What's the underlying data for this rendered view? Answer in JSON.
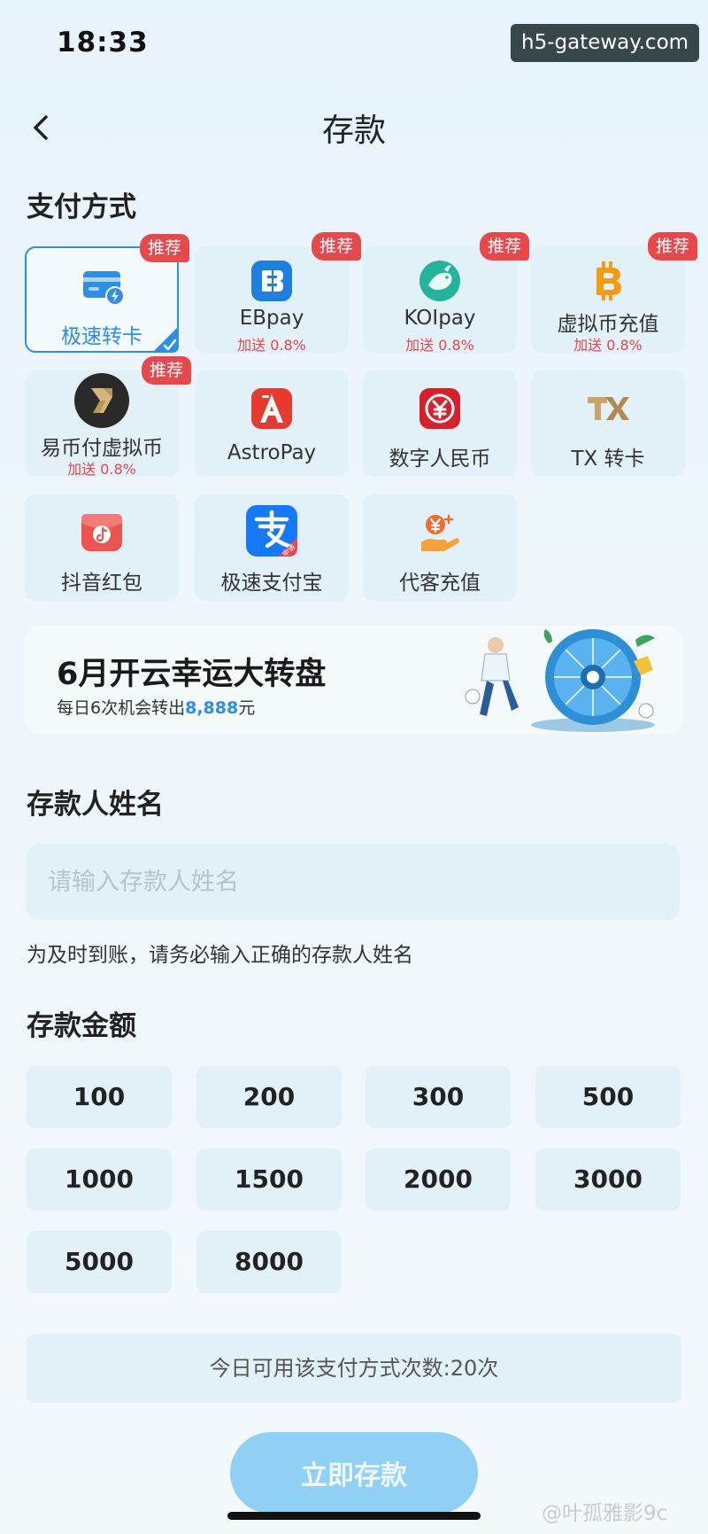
{
  "status_bar": {
    "time": "18:33",
    "host": "h5-gateway.com"
  },
  "header": {
    "title": "存款"
  },
  "payment_section": {
    "title": "支付方式"
  },
  "payment_methods": [
    {
      "label": "极速转卡",
      "badge": "推荐",
      "sub": "",
      "selected": true,
      "icon": "card-flash-icon"
    },
    {
      "label": "EBpay",
      "badge": "推荐",
      "sub": "加送 0.8%",
      "icon": "ebpay-icon"
    },
    {
      "label": "KOIpay",
      "badge": "推荐",
      "sub": "加送 0.8%",
      "icon": "koi-fish-icon"
    },
    {
      "label": "虚拟币充值",
      "badge": "推荐",
      "sub": "加送 0.8%",
      "icon": "bitcoin-icon"
    },
    {
      "label": "易币付虚拟币",
      "badge": "推荐",
      "sub": "加送 0.8%",
      "icon": "yibifu-icon"
    },
    {
      "label": "AstroPay",
      "badge": "",
      "sub": "",
      "icon": "astropay-icon"
    },
    {
      "label": "数字人民币",
      "badge": "",
      "sub": "",
      "icon": "digital-rmb-icon"
    },
    {
      "label": "TX 转卡",
      "badge": "",
      "sub": "",
      "icon": "tx-icon"
    },
    {
      "label": "抖音红包",
      "badge": "",
      "sub": "",
      "icon": "douyin-redpacket-icon"
    },
    {
      "label": "极速支付宝",
      "badge": "",
      "sub": "",
      "icon": "alipay-icon"
    },
    {
      "label": "代客充值",
      "badge": "",
      "sub": "",
      "icon": "agent-recharge-icon"
    }
  ],
  "alipay_tag": "申请",
  "banner": {
    "title": "6月开云幸运大转盘",
    "sub_prefix": "每日6次机会转出",
    "sub_amount": "8,888",
    "sub_suffix": "元"
  },
  "depositor": {
    "title": "存款人姓名",
    "placeholder": "请输入存款人姓名",
    "hint": "为及时到账，请务必输入正确的存款人姓名"
  },
  "amount_section": {
    "title": "存款金额"
  },
  "amounts": [
    "100",
    "200",
    "300",
    "500",
    "1000",
    "1500",
    "2000",
    "3000",
    "5000",
    "8000"
  ],
  "limit_text": "今日可用该支付方式次数:20次",
  "submit_label": "立即存款",
  "watermark": "@叶孤雅影9c",
  "colors": {
    "accent": "#2e8ee6",
    "badge": "#e8474c",
    "submit": "#8fd0f4",
    "card_bg": "#e2f0f8"
  }
}
